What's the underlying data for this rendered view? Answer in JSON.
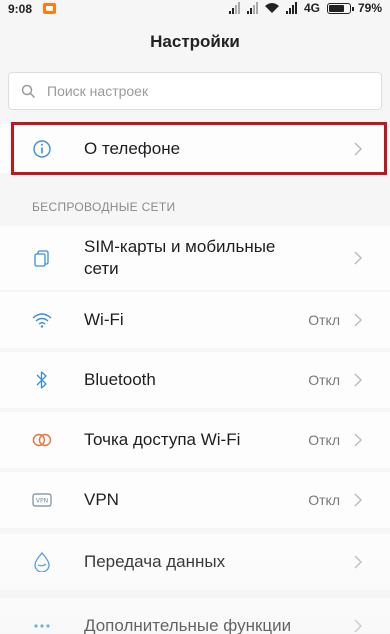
{
  "status_bar": {
    "time": "9:08",
    "network": "4G",
    "battery_percent": "79%",
    "battery_level": 0.79
  },
  "header": {
    "title": "Настройки"
  },
  "search": {
    "placeholder": "Поиск настроек"
  },
  "about": {
    "label": "О телефоне",
    "icon": "info-icon"
  },
  "section": {
    "wireless": "БЕСПРОВОДНЫЕ СЕТИ"
  },
  "items": [
    {
      "label": "SIM-карты и мобильные сети",
      "value": "",
      "icon": "sim-card-icon"
    },
    {
      "label": "Wi-Fi",
      "value": "Откл",
      "icon": "wifi-icon"
    },
    {
      "label": "Bluetooth",
      "value": "Откл",
      "icon": "bluetooth-icon"
    },
    {
      "label": "Точка доступа Wi-Fi",
      "value": "Откл",
      "icon": "hotspot-icon"
    },
    {
      "label": "VPN",
      "value": "Откл",
      "icon": "vpn-icon"
    },
    {
      "label": "Передача данных",
      "value": "",
      "icon": "data-usage-icon"
    },
    {
      "label": "Дополнительные функции",
      "value": "",
      "icon": "more-icon"
    }
  ],
  "colors": {
    "highlight": "#c4151d",
    "accent": "#3b8fd9"
  }
}
